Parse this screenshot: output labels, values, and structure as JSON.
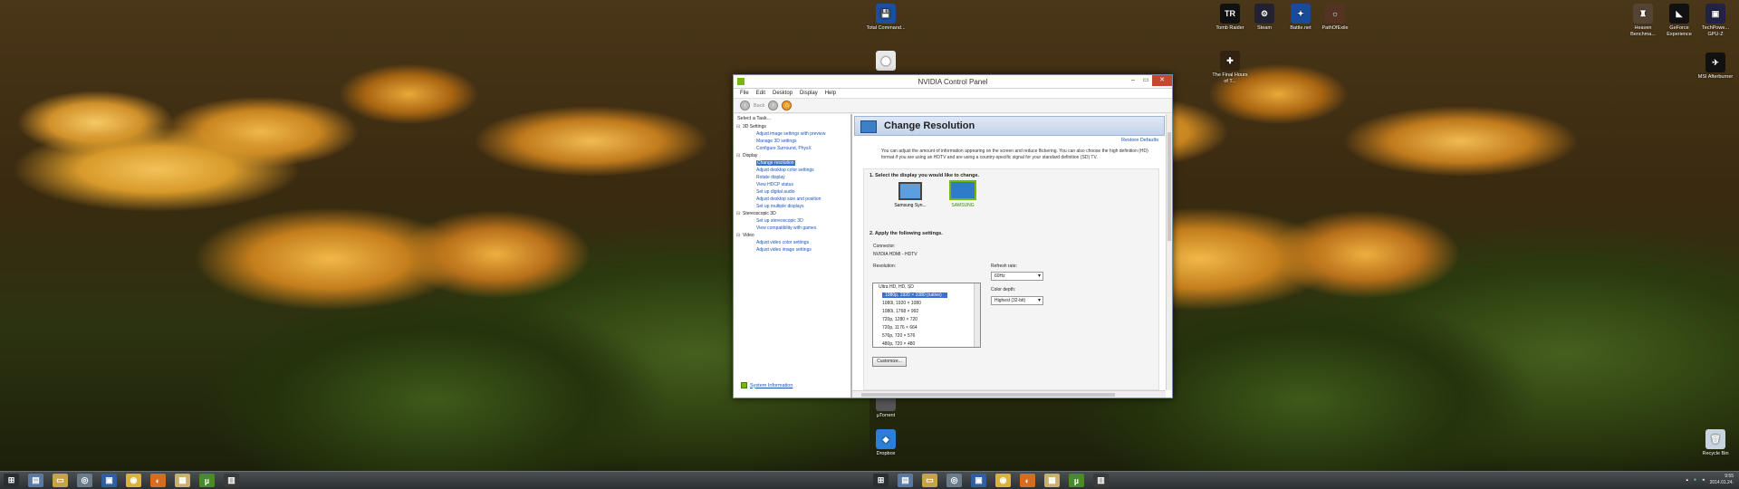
{
  "desktop_left": {
    "icons": [
      {
        "label": "Total Command...",
        "color": "#1f4ea0",
        "glyph": "💾"
      },
      {
        "label": "",
        "color": "#e8e8e8",
        "glyph": "⬤"
      },
      {
        "label": "µTorrent",
        "color": "#555",
        "glyph": ""
      },
      {
        "label": "Dropbox",
        "color": "#2b7fd8",
        "glyph": "◆"
      }
    ]
  },
  "desktop_right": {
    "icons": [
      {
        "label": "Tomb Raider",
        "color": "#111",
        "glyph": "TR"
      },
      {
        "label": "Steam",
        "color": "#223",
        "glyph": "⚙"
      },
      {
        "label": "Battle.net",
        "color": "#1a4a9a",
        "glyph": "✦"
      },
      {
        "label": "PathOfExile",
        "color": "#553322",
        "glyph": "☼"
      },
      {
        "label": "The Final Hours of T...",
        "color": "#332211",
        "glyph": "✚"
      },
      {
        "label": "Heaven Benchma...",
        "color": "#554433",
        "glyph": "♜"
      },
      {
        "label": "GeForce Experience",
        "color": "#111",
        "glyph": "◣"
      },
      {
        "label": "TechPowe... GPU-Z",
        "color": "#224",
        "glyph": "▣"
      },
      {
        "label": "MSI Afterburner",
        "color": "#111",
        "glyph": "✈"
      },
      {
        "label": "Recycle Bin",
        "color": "#c8d4e0",
        "glyph": "🗑"
      }
    ]
  },
  "taskbar": {
    "icons": [
      {
        "name": "start-icon",
        "color": "#2a2e31",
        "glyph": "⊞"
      },
      {
        "name": "file-icon",
        "color": "#5a78a0",
        "glyph": "▤"
      },
      {
        "name": "folder-icon",
        "color": "#c7a24a",
        "glyph": "▭"
      },
      {
        "name": "network-icon",
        "color": "#6a7b8a",
        "glyph": "◎"
      },
      {
        "name": "save-icon",
        "color": "#2f5f9e",
        "glyph": "▣"
      },
      {
        "name": "chrome-icon",
        "color": "#d8b43a",
        "glyph": "◉"
      },
      {
        "name": "firefox-icon",
        "color": "#d86c1e",
        "glyph": "◐"
      },
      {
        "name": "calc-icon",
        "color": "#c8b070",
        "glyph": "▦"
      },
      {
        "name": "utorrent-icon",
        "color": "#4a8a2a",
        "glyph": "µ"
      },
      {
        "name": "gpu-icon",
        "color": "#3a3a3a",
        "glyph": "▥"
      }
    ],
    "clock_time": "9:55",
    "clock_date": "2014.01.24."
  },
  "window": {
    "title": "NVIDIA Control Panel",
    "menu": [
      "File",
      "Edit",
      "Desktop",
      "Display",
      "Help"
    ],
    "back_label": "Back",
    "task_heading": "Select a Task...",
    "tree": [
      {
        "type": "cat",
        "label": "3D Settings"
      },
      {
        "type": "item",
        "label": "Adjust image settings with preview"
      },
      {
        "type": "item",
        "label": "Manage 3D settings"
      },
      {
        "type": "item",
        "label": "Configure Surround, PhysX"
      },
      {
        "type": "cat",
        "label": "Display"
      },
      {
        "type": "item",
        "label": "Change resolution",
        "selected": true
      },
      {
        "type": "item",
        "label": "Adjust desktop color settings"
      },
      {
        "type": "item",
        "label": "Rotate display"
      },
      {
        "type": "item",
        "label": "View HDCP status"
      },
      {
        "type": "item",
        "label": "Set up digital audio"
      },
      {
        "type": "item",
        "label": "Adjust desktop size and position"
      },
      {
        "type": "item",
        "label": "Set up multiple displays"
      },
      {
        "type": "cat",
        "label": "Stereoscopic 3D"
      },
      {
        "type": "item",
        "label": "Set up stereoscopic 3D"
      },
      {
        "type": "item",
        "label": "View compatibility with games"
      },
      {
        "type": "cat",
        "label": "Video"
      },
      {
        "type": "item",
        "label": "Adjust video color settings"
      },
      {
        "type": "item",
        "label": "Adjust video image settings"
      }
    ],
    "system_info": "System Information",
    "page": {
      "title": "Change Resolution",
      "restore_defaults": "Restore Defaults",
      "description": "You can adjust the amount of information appearing on the screen and reduce flickering. You can also choose the high definition (HD) format if you are using an HDTV and are using a country-specific signal for your standard definition (SD) TV.",
      "section1": "1. Select the display you would like to change.",
      "display1": "Samsung Syn...",
      "display2": "SAMSUNG",
      "section2": "2. Apply the following settings.",
      "connector_label": "Connector:",
      "connector_value": "NVIDIA HDMI - HDTV",
      "resolution_label": "Resolution:",
      "resolutions": [
        {
          "label": "Ultra HD, HD, SD",
          "group": true
        },
        {
          "label": "1080p, 1920 × 1080 (native)",
          "selected": true
        },
        {
          "label": "1080i, 1920 × 1080"
        },
        {
          "label": "1080i, 1768 × 992"
        },
        {
          "label": "720p, 1280 × 720"
        },
        {
          "label": "720p, 1176 × 664"
        },
        {
          "label": "576p, 720 × 576"
        },
        {
          "label": "480p, 720 × 480"
        }
      ],
      "refresh_label": "Refresh rate:",
      "refresh_value": "60Hz",
      "depth_label": "Color depth:",
      "depth_value": "Highest (32-bit)",
      "customize": "Customize..."
    }
  }
}
